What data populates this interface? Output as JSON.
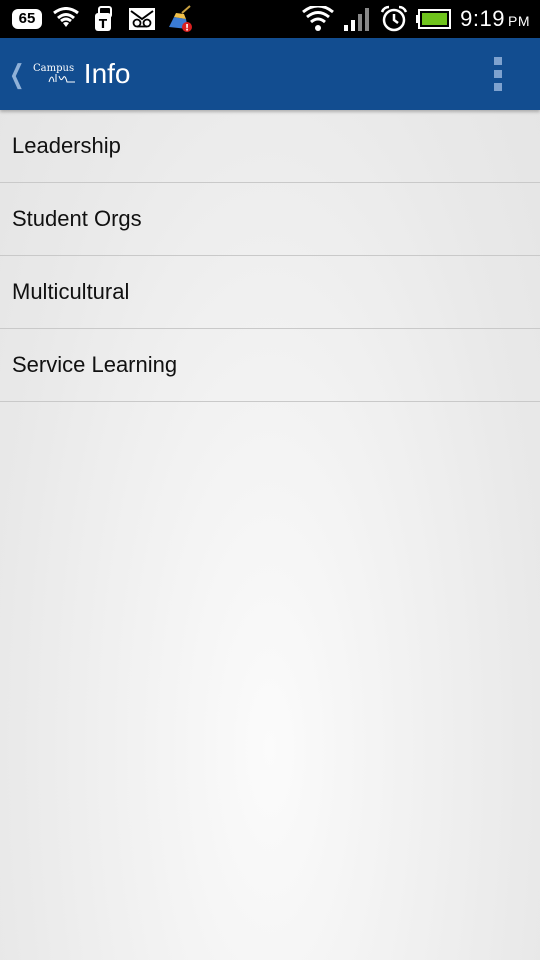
{
  "status_bar": {
    "notification_count": "65",
    "time": "9:19",
    "ampm": "PM",
    "icons": [
      "tmobile-wifi-icon",
      "tmobile-apps-icon",
      "voicemail-icon",
      "cleaner-alert-icon",
      "wifi-signal-icon",
      "cell-signal-icon",
      "alarm-icon",
      "battery-icon"
    ]
  },
  "action_bar": {
    "title": "Info",
    "logo_text": "Campus Life",
    "background": "#124d90"
  },
  "list": {
    "items": [
      {
        "label": "Leadership"
      },
      {
        "label": "Student Orgs"
      },
      {
        "label": "Multicultural"
      },
      {
        "label": "Service Learning"
      }
    ]
  }
}
